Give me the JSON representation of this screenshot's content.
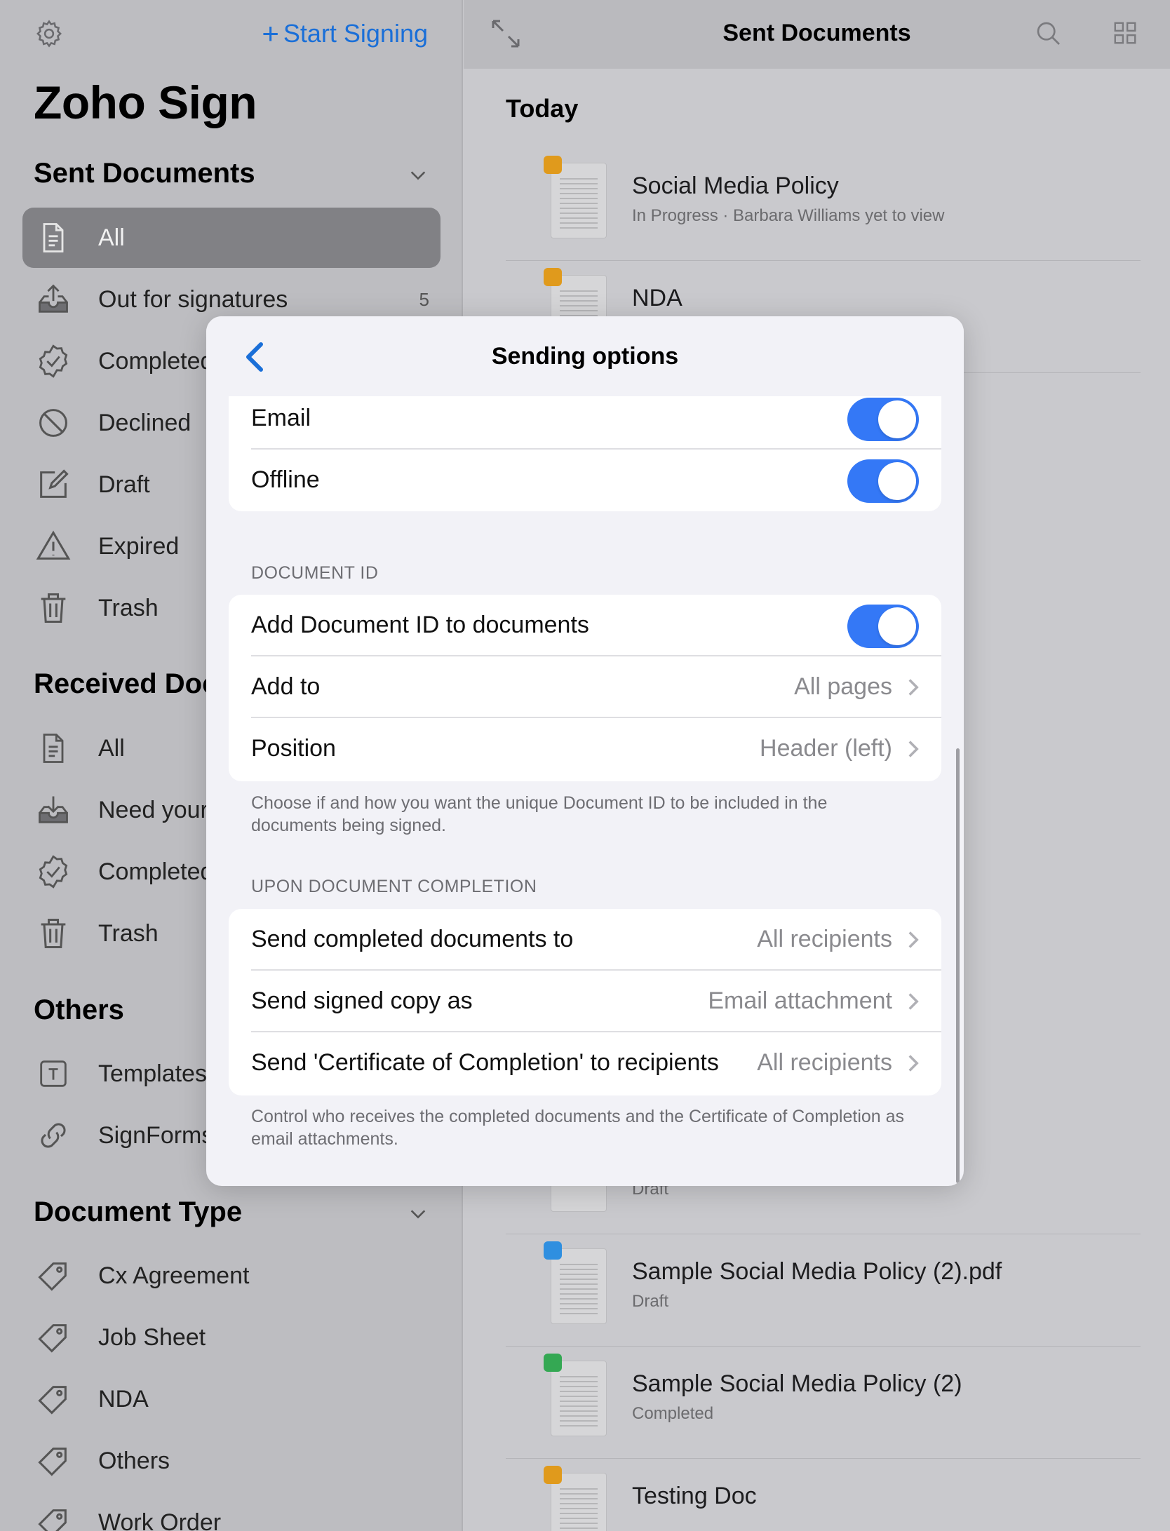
{
  "sidebar": {
    "start_signing": "Start Signing",
    "app_title": "Zoho Sign",
    "sent_header": "Sent Documents",
    "sent_items": [
      {
        "label": "All"
      },
      {
        "label": "Out for signatures",
        "count": "5"
      },
      {
        "label": "Completed"
      },
      {
        "label": "Declined"
      },
      {
        "label": "Draft"
      },
      {
        "label": "Expired"
      },
      {
        "label": "Trash"
      }
    ],
    "received_header": "Received Doc",
    "received_items": [
      {
        "label": "All"
      },
      {
        "label": "Need your s"
      },
      {
        "label": "Completed"
      },
      {
        "label": "Trash"
      }
    ],
    "others_header": "Others",
    "others_items": [
      {
        "label": "Templates"
      },
      {
        "label": "SignForms"
      }
    ],
    "doctype_header": "Document Type",
    "doctype_items": [
      {
        "label": "Cx Agreement"
      },
      {
        "label": "Job Sheet"
      },
      {
        "label": "NDA"
      },
      {
        "label": "Others"
      },
      {
        "label": "Work Order"
      }
    ]
  },
  "main": {
    "title": "Sent Documents",
    "section": "Today",
    "documents": [
      {
        "name": "Social Media Policy",
        "status": "In Progress · Barbara Williams yet to view",
        "badge_color": "#e09a1c"
      },
      {
        "name": "NDA",
        "status": "",
        "badge_color": "#e09a1c"
      },
      {
        "name": "",
        "status": "Draft",
        "badge_color": ""
      },
      {
        "name": "Sample Social Media Policy (2).pdf",
        "status": "Draft",
        "badge_color": "#2f8fe0"
      },
      {
        "name": "Sample Social Media Policy (2)",
        "status": "Completed",
        "badge_color": "#34a853"
      },
      {
        "name": "Testing Doc",
        "status": "",
        "badge_color": "#e09a1c"
      }
    ]
  },
  "modal": {
    "title": "Sending options",
    "delivery": [
      {
        "label": "Email",
        "on": true
      },
      {
        "label": "Offline",
        "on": true
      }
    ],
    "docid_section": "DOCUMENT ID",
    "docid_rows": {
      "add_id": {
        "label": "Add Document ID to documents",
        "on": true
      },
      "add_to": {
        "label": "Add to",
        "value": "All pages"
      },
      "position": {
        "label": "Position",
        "value": "Header (left)"
      }
    },
    "docid_footnote": "Choose if and how you want the unique Document ID to be included in the documents being signed.",
    "completion_section": "UPON DOCUMENT COMPLETION",
    "completion_rows": [
      {
        "label": "Send completed documents to",
        "value": "All recipients"
      },
      {
        "label": "Send signed copy as",
        "value": "Email attachment"
      },
      {
        "label": "Send 'Certificate of Completion' to recipients",
        "value": "All recipients"
      }
    ],
    "completion_footnote": "Control who receives the completed documents and the Certificate of Completion as email attachments."
  },
  "colors": {
    "accent": "#1a6fd8",
    "toggle_on": "#3478f6",
    "selected_row": "#818185"
  }
}
